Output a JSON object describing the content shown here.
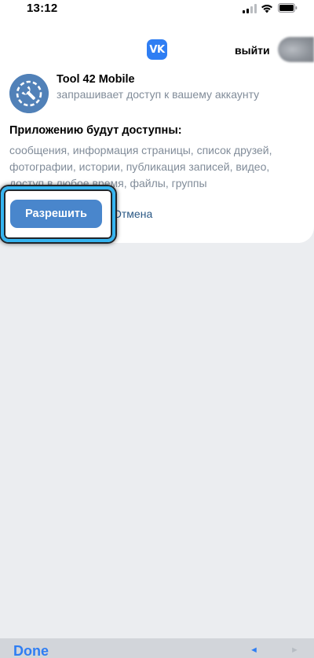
{
  "status_bar": {
    "time": "13:12"
  },
  "header": {
    "logo_text": "VK",
    "logout_label": "выйти"
  },
  "app": {
    "name": "Tool 42 Mobile",
    "subtitle": "запрашивает доступ к вашему аккаунту"
  },
  "permissions": {
    "title": "Приложению будут доступны:",
    "list": "сообщения, информация страницы, список друзей, фотографии, истории, публикация записей, видео, доступ в любое время, файлы, группы"
  },
  "actions": {
    "allow_label": "Разрешить",
    "cancel_label": "Отмена"
  },
  "toolbar": {
    "done_label": "Done",
    "prev_glyph": "◄",
    "next_glyph": "►"
  },
  "colors": {
    "accent": "#2f7ef3",
    "button": "#4986cc",
    "link": "#2a5885",
    "highlight": "#35b4f0",
    "app_icon": "#5181b8",
    "muted_text": "#818c99",
    "background": "#ebedf0"
  },
  "icons": {
    "signal": "cellular-signal-icon",
    "wifi": "wifi-icon",
    "battery": "battery-icon",
    "app": "wrench-icon"
  }
}
